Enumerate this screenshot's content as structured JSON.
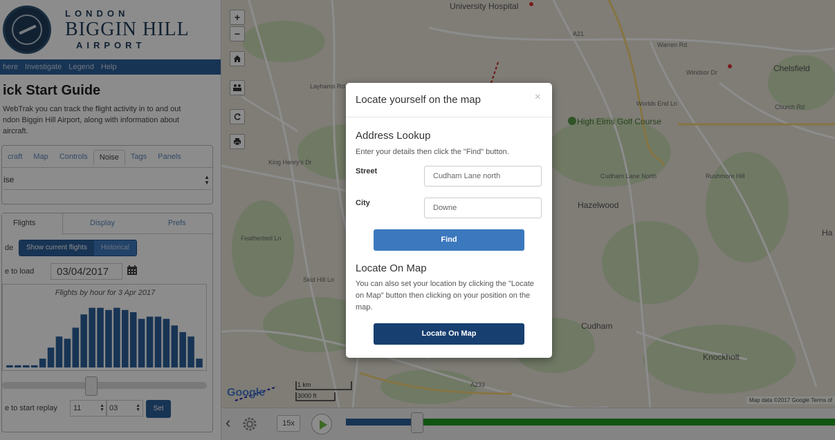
{
  "logo": {
    "line1": "LONDON",
    "line2": "BIGGIN HILL",
    "line3": "AIRPORT"
  },
  "topnav": [
    "here",
    "Investigate",
    "Legend",
    "Help"
  ],
  "quickstart": {
    "title": "ick Start Guide",
    "lines": [
      "WebTrak you can track the flight activity in to and out",
      "ndon Biggin Hill Airport, along with information about",
      "aircraft."
    ]
  },
  "panel_tabs": [
    "craft",
    "Map",
    "Controls",
    "Noise",
    "Tags",
    "Panels"
  ],
  "noise_select": "ise",
  "flight_tabs": {
    "flights": "Flights",
    "display": "Display",
    "prefs": "Prefs"
  },
  "mode": {
    "label": "de",
    "current": "Show current flights",
    "historical": "Historical"
  },
  "date_load": {
    "label": "e to load",
    "value": "03/04/2017"
  },
  "chart_data": {
    "type": "bar",
    "title": "Flights by hour for 3 Apr 2017",
    "values": [
      1,
      1,
      1,
      1,
      4,
      9,
      14,
      13,
      18,
      24,
      27,
      27,
      26,
      27,
      26,
      25,
      22,
      23,
      23,
      22,
      19,
      16,
      14,
      4
    ],
    "ylim": [
      0,
      30
    ]
  },
  "replay": {
    "label": "e to start replay",
    "hour": "11",
    "minute": "03",
    "set": "Set"
  },
  "map": {
    "labels": [
      {
        "text": "University Hospital"
      },
      {
        "text": "A21"
      },
      {
        "text": "Warren Rd"
      },
      {
        "text": "Chelsfield"
      },
      {
        "text": "Windsor Dr"
      },
      {
        "text": "High Elms Golf Course"
      },
      {
        "text": "Hazelwood"
      },
      {
        "text": "Cudham"
      },
      {
        "text": "Knockholt"
      },
      {
        "text": "Cudham Lane North"
      },
      {
        "text": "Layhams Rd"
      },
      {
        "text": "King Henry's Dr"
      },
      {
        "text": "Featherbed Ln"
      },
      {
        "text": "Skid Hill Ln"
      },
      {
        "text": "Church Rd"
      },
      {
        "text": "A233"
      },
      {
        "text": "Rushmore Hill"
      },
      {
        "text": "Worlds End Ln"
      },
      {
        "text": "Ha"
      }
    ],
    "google": "Google",
    "scale_km": "1 km",
    "scale_ft": "3000 ft",
    "attribution": "Map data ©2017 Google  Terms of"
  },
  "timeline": {
    "speed": "15x"
  },
  "modal": {
    "title": "Locate yourself on the map",
    "close": "×",
    "address_title": "Address Lookup",
    "address_text": "Enter your details then click the \"Find\" button.",
    "street_label": "Street",
    "street_value": "Cudham Lane north",
    "city_label": "City",
    "city_value": "Downe",
    "find": "Find",
    "locate_title": "Locate On Map",
    "locate_text": "You can also set your location by clicking the \"Locate on Map\" button then clicking on your position on the map.",
    "locate_button": "Locate On Map"
  },
  "colors": {
    "nav": "#2d5f99",
    "find_button": "#3b78bd",
    "locate_button": "#173f70",
    "bars": "#2d5f99"
  }
}
